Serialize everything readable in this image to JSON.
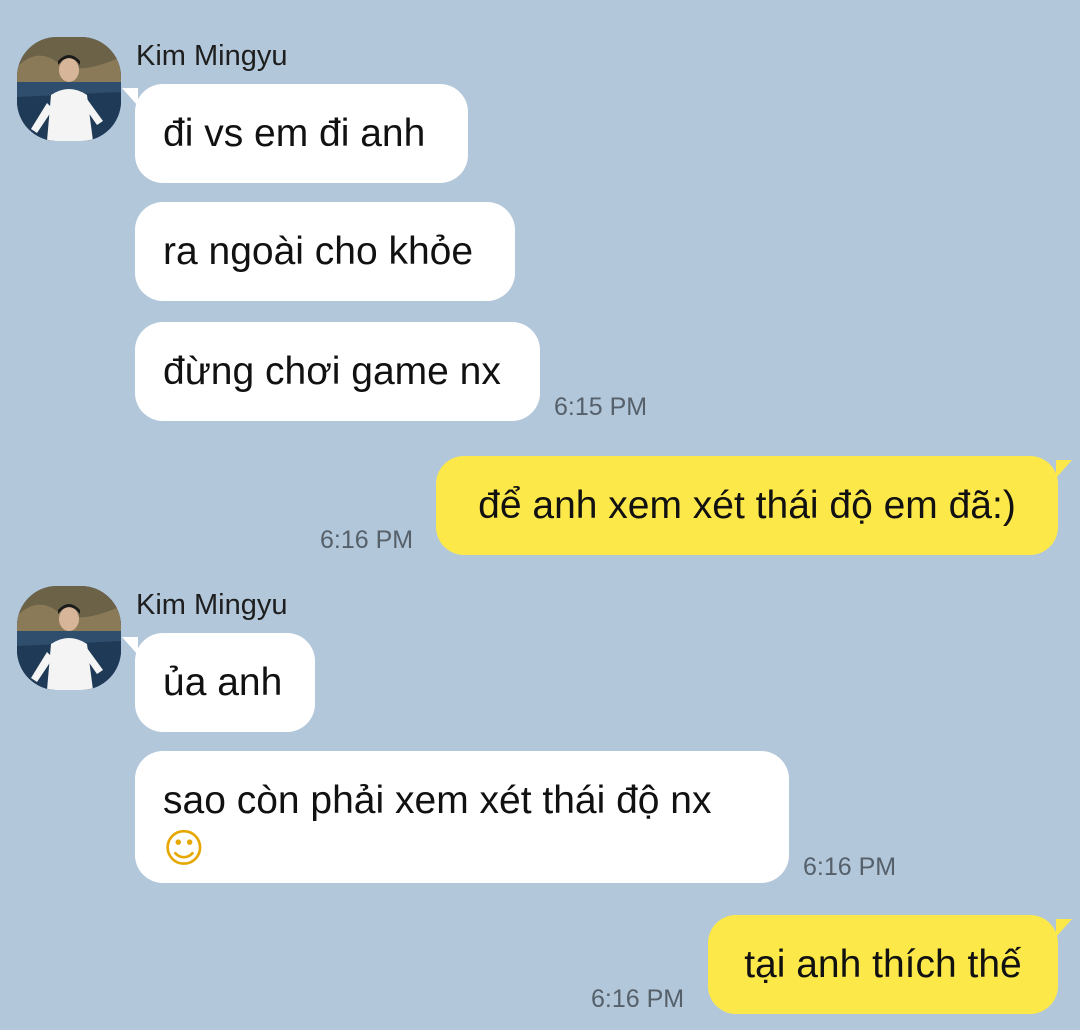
{
  "chat": {
    "groups": [
      {
        "sender": "Kim Mingyu",
        "messages": [
          "đi vs em đi anh",
          "ra ngoài cho khỏe",
          "đừng chơi game nx"
        ],
        "time": "6:15 PM"
      },
      {
        "outgoing": "để anh xem xét thái độ em đã:)",
        "time": "6:16 PM"
      },
      {
        "sender": "Kim Mingyu",
        "messages": [
          "ủa anh",
          "sao còn phải xem xét thái độ nx"
        ],
        "emoji": "☺",
        "time": "6:16 PM"
      },
      {
        "outgoing": "tại anh thích thế",
        "time": "6:16 PM"
      }
    ]
  },
  "colors": {
    "background": "#b2c7da",
    "incoming_bubble": "#ffffff",
    "outgoing_bubble": "#fde84a"
  },
  "icons": {
    "avatar": "profile-photo-icon",
    "emoji": "smiling-face-icon"
  }
}
